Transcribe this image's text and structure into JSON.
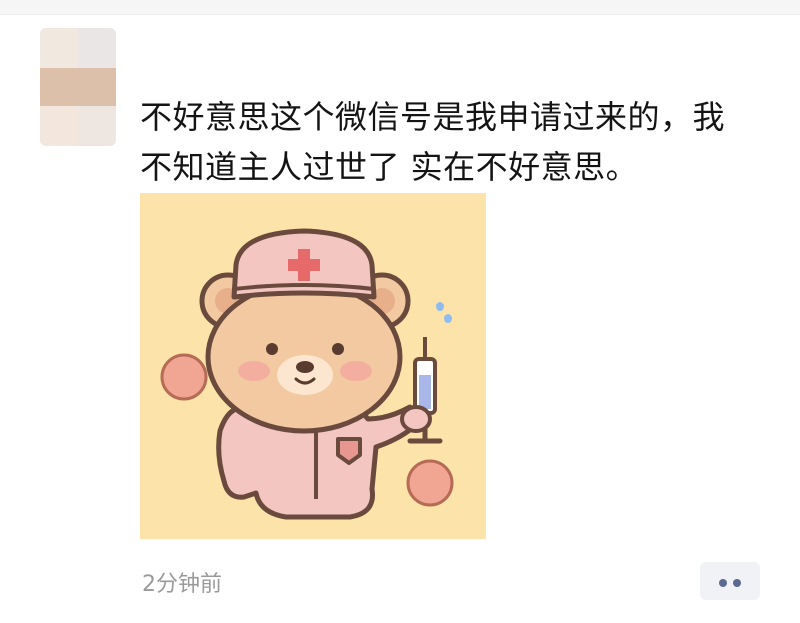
{
  "post": {
    "text_line1": "不好意思这个微信号是我申请过来的，我",
    "text_line2": "不知道主人过世了 实在不好意思。",
    "time": "2分钟前"
  },
  "photo": {
    "icon": "nurse-bear-illustration",
    "background_color": "#fbe3a9"
  },
  "more_button": {
    "icon": "more-dots-icon",
    "color": "#5b6a90"
  },
  "avatar": {
    "icon": "blurred-avatar"
  }
}
